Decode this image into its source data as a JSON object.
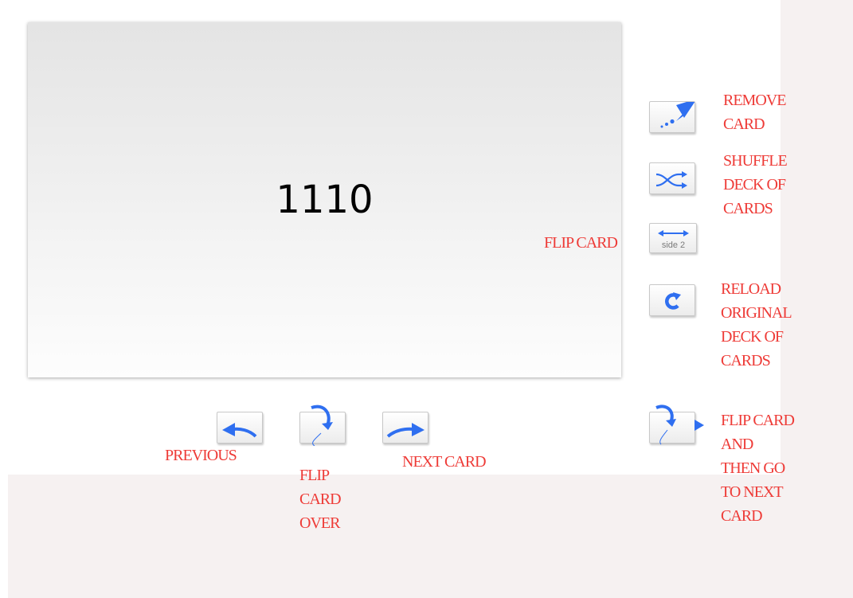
{
  "card": {
    "text": "1110"
  },
  "labels": {
    "remove_card": [
      "REMOVE",
      "CARD"
    ],
    "shuffle": [
      "SHUFFLE",
      "DECK OF",
      "CARDS"
    ],
    "flip_card": "FLIP CARD",
    "reload": [
      "RELOAD",
      "ORIGINAL",
      "DECK OF",
      "CARDS"
    ],
    "flip_then_next": [
      "FLIP CARD",
      "AND",
      "THEN GO",
      "TO NEXT",
      "CARD"
    ],
    "previous": "PREVIOUS",
    "flip_over": [
      "FLIP",
      "CARD",
      "OVER"
    ],
    "next_card": "NEXT CARD"
  },
  "buttons": {
    "flip_card_sub": "side 2"
  },
  "icons": {
    "remove": "remove-card-icon",
    "shuffle": "shuffle-icon",
    "flip": "flip-side-icon",
    "reload": "reload-icon",
    "flip_next": "flip-next-icon",
    "previous": "arrow-left-icon",
    "flip_over": "flip-over-icon",
    "next": "arrow-right-icon"
  },
  "colors": {
    "accent": "#2f6ff0",
    "label": "#ee3b37"
  }
}
